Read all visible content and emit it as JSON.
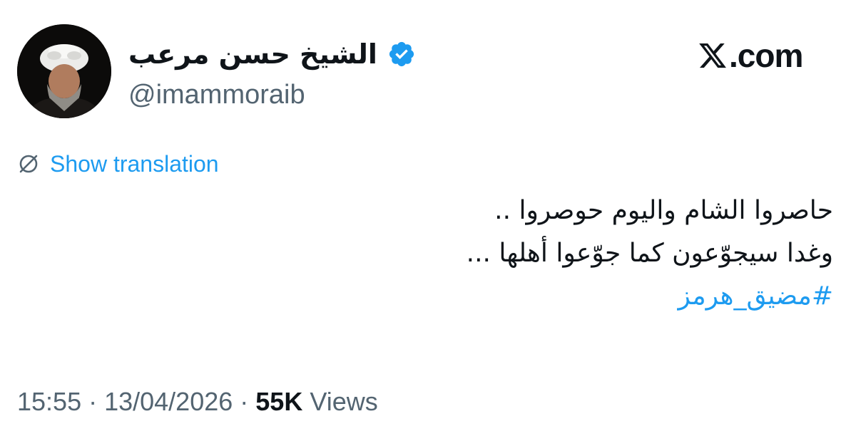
{
  "author": {
    "display_name": "الشيخ حسن مرعب",
    "handle": "@imammoraib",
    "verified_icon": "verified-badge-icon",
    "avatar_icon": "profile-photo"
  },
  "brand": {
    "logo_icon": "x-logo-icon",
    "domain_text": ".com"
  },
  "translation": {
    "icon": "globe-icon",
    "label": "Show translation"
  },
  "tweet": {
    "lines": [
      "حاصروا الشام واليوم حوصروا ..",
      "وغدا سيجوّعون كما جوّعوا أهلها ..."
    ],
    "hashtag": "#مضيق_هرمز"
  },
  "meta": {
    "time": "15:55",
    "separator": " · ",
    "date": "13/04/2026",
    "views_count": "55K",
    "views_label": " Views"
  },
  "colors": {
    "accent": "#1d9bf0",
    "text_primary": "#0f1419",
    "text_secondary": "#536471"
  }
}
